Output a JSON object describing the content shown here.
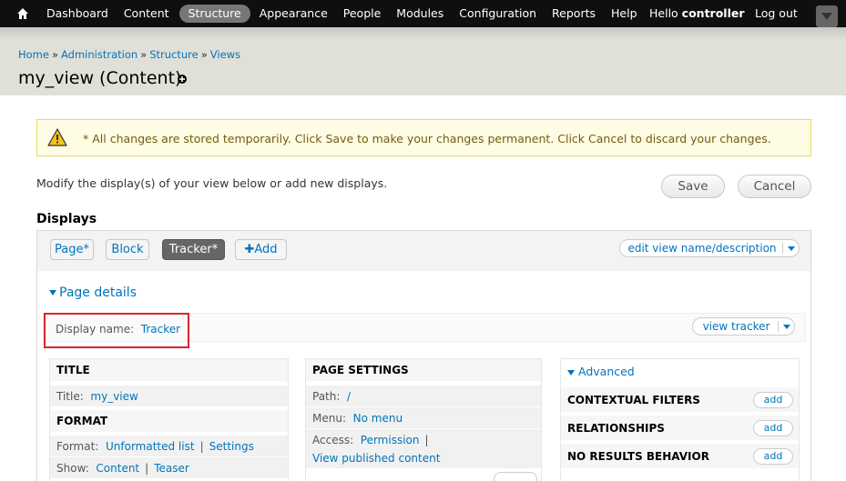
{
  "toolbar": {
    "items": [
      "Dashboard",
      "Content",
      "Structure",
      "Appearance",
      "People",
      "Modules",
      "Configuration",
      "Reports",
      "Help"
    ],
    "active_item": "Structure",
    "hello_prefix": "Hello",
    "username": "controller",
    "logout": "Log out"
  },
  "breadcrumb": {
    "items": [
      "Home",
      "Administration",
      "Structure",
      "Views"
    ],
    "separator": "»"
  },
  "page_title": "my_view (Content)",
  "message": {
    "text": "* All changes are stored temporarily. Click Save to make your changes permanent. Click Cancel to discard your changes.",
    "type": "warning"
  },
  "intro_text": "Modify the display(s) of your view below or add new displays.",
  "buttons": {
    "save": "Save",
    "cancel": "Cancel"
  },
  "displays_heading": "Displays",
  "display_tabs": {
    "page": "Page*",
    "block": "Block",
    "tracker": "Tracker*",
    "add": "Add",
    "active": "Tracker*"
  },
  "edit_view_name": "edit view name/description",
  "page_details": "Page details",
  "display_name": {
    "label": "Display name:",
    "value": "Tracker"
  },
  "view_tracker": "view tracker",
  "col1": {
    "title_heading": "TITLE",
    "title_label": "Title:",
    "title_value": "my_view",
    "format_heading": "FORMAT",
    "format_label": "Format:",
    "format_value": "Unformatted list",
    "format_settings": "Settings",
    "show_label": "Show:",
    "show_value": "Content",
    "show_teaser": "Teaser"
  },
  "col2": {
    "heading": "PAGE SETTINGS",
    "path_label": "Path:",
    "path_value": "/",
    "menu_label": "Menu:",
    "menu_value": "No menu",
    "access_label": "Access:",
    "access_value": "Permission",
    "access_value2": "View published content"
  },
  "col3": {
    "advanced": "Advanced",
    "contextual_filters": "CONTEXTUAL FILTERS",
    "relationships": "RELATIONSHIPS",
    "no_results": "NO RESULTS BEHAVIOR",
    "add_label": "add"
  },
  "colors": {
    "toolbar_bg": "#0f0f0f",
    "link": "#0074bd",
    "warning_bg": "#fffce5",
    "highlight_border": "#d9262a"
  }
}
